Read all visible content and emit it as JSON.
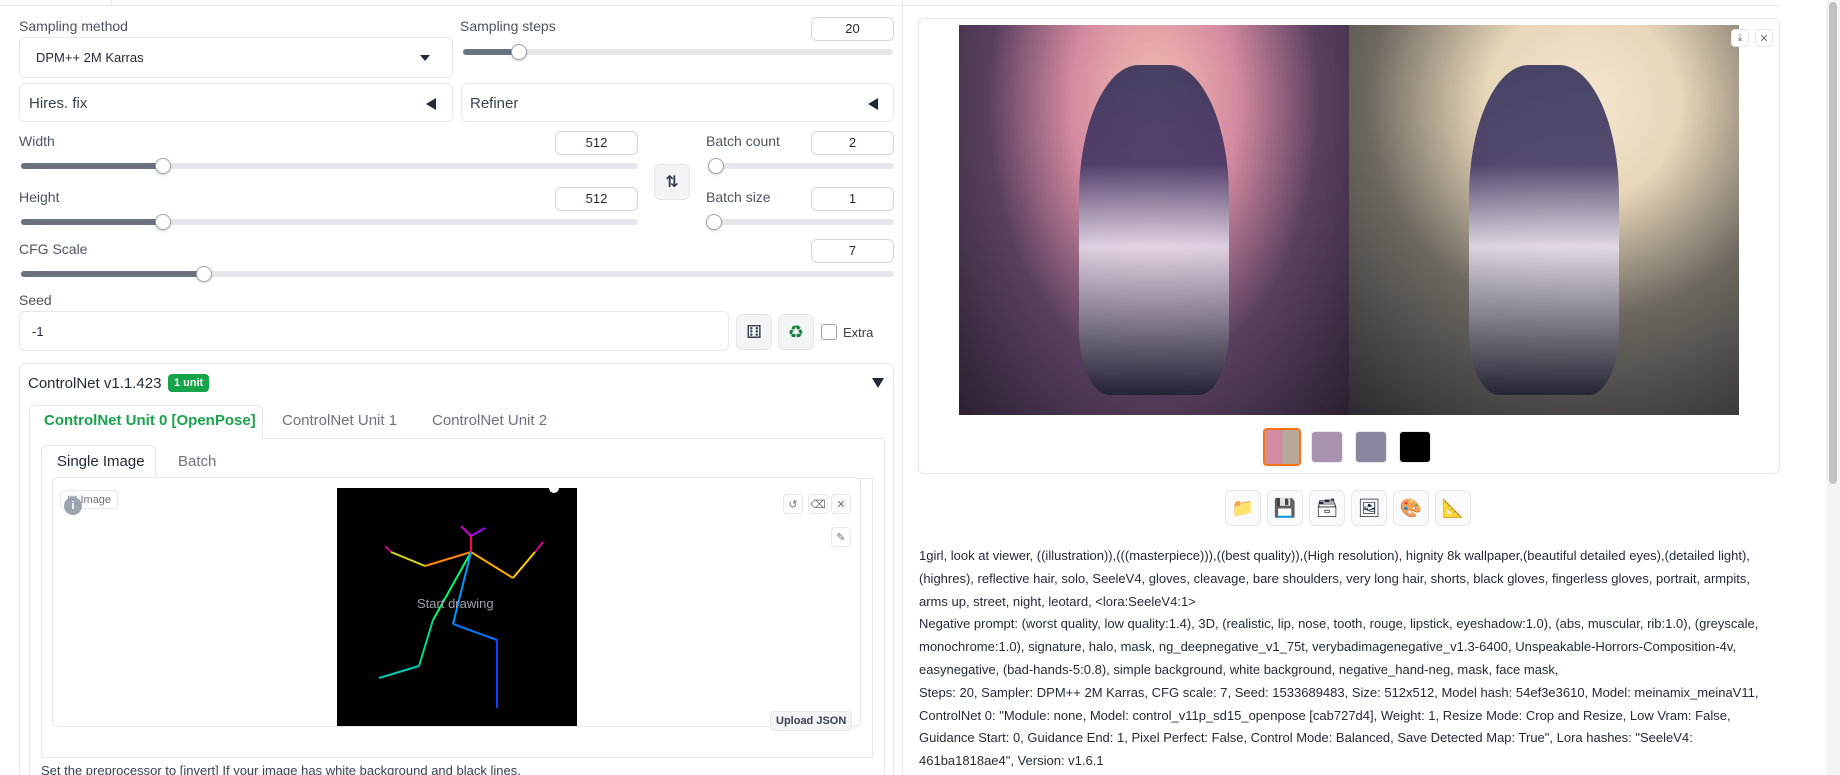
{
  "sampling": {
    "method_label": "Sampling method",
    "method_value": "DPM++ 2M Karras",
    "steps_label": "Sampling steps",
    "steps_value": "20",
    "steps_fraction": 0.13
  },
  "accordions": {
    "hires": "Hires. fix",
    "refiner": "Refiner"
  },
  "size": {
    "width_label": "Width",
    "width_value": "512",
    "width_fraction": 0.23,
    "height_label": "Height",
    "height_value": "512",
    "height_fraction": 0.23
  },
  "batch": {
    "count_label": "Batch count",
    "count_value": "2",
    "count_fraction": 0.01,
    "size_label": "Batch size",
    "size_value": "1",
    "size_fraction": 0.0
  },
  "cfg": {
    "label": "CFG Scale",
    "value": "7",
    "fraction": 0.21
  },
  "seed": {
    "label": "Seed",
    "value": "-1",
    "extra_label": "Extra"
  },
  "controlnet": {
    "title": "ControlNet v1.1.423",
    "badge": "1 unit",
    "units": [
      "ControlNet Unit 0 [OpenPose]",
      "ControlNet Unit 1",
      "ControlNet Unit 2"
    ],
    "subtabs": [
      "Single Image",
      "Batch"
    ],
    "image_label": "Image",
    "canvas_text": "Start drawing",
    "upload_json": "Upload JSON",
    "hint": "Set the preprocessor to [invert] If your image has white background and black lines."
  },
  "output": {
    "toolbar_icons": [
      "folder-icon",
      "save-icon",
      "zip-icon",
      "send-to-img2img-icon",
      "send-to-inpaint-icon",
      "send-to-extras-icon"
    ],
    "info_prompt": "1girl, look at viewer, ((illustration)),(((masterpiece))),((best quality)),(High resolution), hignity 8k wallpaper,(beautiful detailed eyes),(detailed light),(highres), reflective hair, solo, SeeleV4, gloves, cleavage, bare shoulders, very long hair, shorts, black gloves, fingerless gloves, portrait, armpits, arms up, street, night, leotard, <lora:SeeleV4:1>",
    "info_negative": "Negative prompt: (worst quality, low quality:1.4), 3D, (realistic, lip, nose, tooth, rouge, lipstick, eyeshadow:1.0), (abs, muscular, rib:1.0), (greyscale, monochrome:1.0), signature, halo, mask, ng_deepnegative_v1_75t, verybadimagenegative_v1.3-6400, Unspeakable-Horrors-Composition-4v, easynegative, (bad-hands-5:0.8), simple background, white background, negative_hand-neg, mask, face mask,",
    "info_params": "Steps: 20, Sampler: DPM++ 2M Karras, CFG scale: 7, Seed: 1533689483, Size: 512x512, Model hash: 54ef3e3610, Model: meinamix_meinaV11, ControlNet 0: \"Module: none, Model: control_v11p_sd15_openpose [cab727d4], Weight: 1, Resize Mode: Crop and Resize, Low Vram: False, Guidance Start: 0, Guidance End: 1, Pixel Perfect: False, Control Mode: Balanced, Save Detected Map: True\", Lora hashes: \"SeeleV4: 461ba1818ae4\", Version: v1.6.1"
  },
  "colors": {
    "accent": "#16a34a",
    "selected_thumb": "#f97316",
    "canvas_bg": "#000000"
  }
}
